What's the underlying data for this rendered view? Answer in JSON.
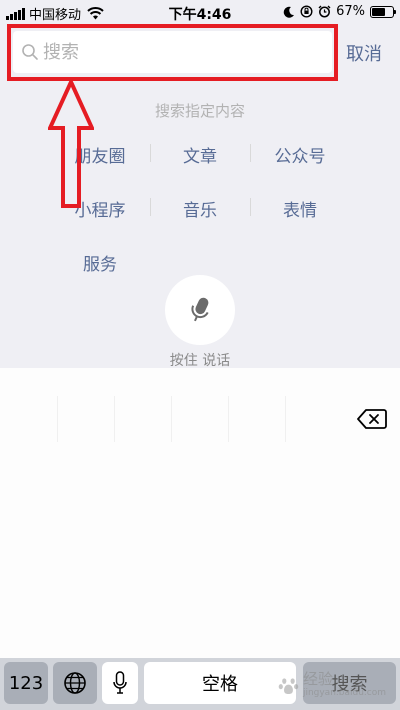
{
  "status_bar": {
    "carrier": "中国移动",
    "time": "下午4:46",
    "battery_percent": "67%",
    "battery_level": 0.67
  },
  "search": {
    "placeholder": "搜索",
    "cancel_label": "取消"
  },
  "hint": "搜索指定内容",
  "categories": [
    {
      "label": "朋友圈"
    },
    {
      "label": "文章"
    },
    {
      "label": "公众号"
    },
    {
      "label": "小程序"
    },
    {
      "label": "音乐"
    },
    {
      "label": "表情"
    },
    {
      "label": "服务"
    }
  ],
  "voice": {
    "label": "按住 说话",
    "icon": "microphone-icon"
  },
  "keyboard": {
    "numbers_key": "123",
    "globe_icon": "globe-icon",
    "mic_icon": "microphone-icon",
    "space_key": "空格",
    "search_key": "搜索",
    "delete_icon": "backspace-icon"
  },
  "watermark": {
    "text": "经验",
    "subtext": "jingyan.baidu.com"
  },
  "colors": {
    "accent": "#576b95",
    "highlight": "#e51c23",
    "background": "#efeff4"
  }
}
